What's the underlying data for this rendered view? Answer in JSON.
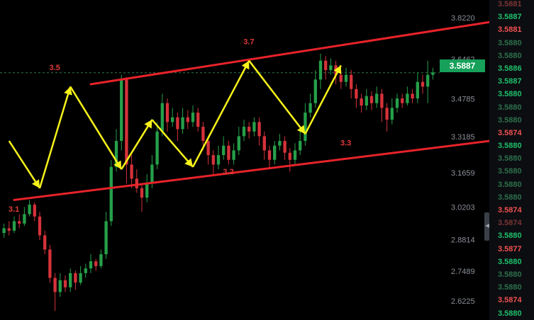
{
  "chart_data": {
    "type": "candlestick",
    "title": "",
    "xlabel": "",
    "ylabel": "",
    "ylim": [
      2.58,
      3.9
    ],
    "y_ticks": [
      "3.8220",
      "3.6462",
      "3.4785",
      "3.3185",
      "3.1659",
      "3.0203",
      "2.8814",
      "2.7489",
      "2.6225"
    ],
    "current_price": "3.5887",
    "current_price_line": 3.5887,
    "candles": [
      [
        2.91,
        2.93,
        2.95,
        2.89
      ],
      [
        2.93,
        2.92,
        2.96,
        2.9
      ],
      [
        2.92,
        2.96,
        2.98,
        2.91
      ],
      [
        2.96,
        2.95,
        2.99,
        2.93
      ],
      [
        2.95,
        2.99,
        3.02,
        2.94
      ],
      [
        2.99,
        3.03,
        3.05,
        2.98
      ],
      [
        3.03,
        2.98,
        3.04,
        2.96
      ],
      [
        2.98,
        2.9,
        3.0,
        2.88
      ],
      [
        2.9,
        2.84,
        2.92,
        2.82
      ],
      [
        2.84,
        2.72,
        2.86,
        2.7
      ],
      [
        2.72,
        2.66,
        2.74,
        2.58
      ],
      [
        2.66,
        2.71,
        2.74,
        2.64
      ],
      [
        2.71,
        2.68,
        2.73,
        2.66
      ],
      [
        2.68,
        2.74,
        2.76,
        2.66
      ],
      [
        2.74,
        2.7,
        2.75,
        2.67
      ],
      [
        2.7,
        2.74,
        2.77,
        2.69
      ],
      [
        2.74,
        2.76,
        2.78,
        2.72
      ],
      [
        2.76,
        2.79,
        2.82,
        2.74
      ],
      [
        2.79,
        2.77,
        2.8,
        2.75
      ],
      [
        2.77,
        2.82,
        2.84,
        2.76
      ],
      [
        2.82,
        2.96,
        3.0,
        2.8
      ],
      [
        2.96,
        3.19,
        3.22,
        2.94
      ],
      [
        3.19,
        3.3,
        3.35,
        3.17
      ],
      [
        3.3,
        3.56,
        3.58,
        3.26
      ],
      [
        3.56,
        3.2,
        3.57,
        3.12
      ],
      [
        3.2,
        3.14,
        3.24,
        3.1
      ],
      [
        3.14,
        3.1,
        3.18,
        3.08
      ],
      [
        3.1,
        3.06,
        3.12,
        3.0
      ],
      [
        3.06,
        3.12,
        3.16,
        3.04
      ],
      [
        3.12,
        3.2,
        3.24,
        3.1
      ],
      [
        3.2,
        3.34,
        3.38,
        3.18
      ],
      [
        3.34,
        3.46,
        3.5,
        3.32
      ],
      [
        3.46,
        3.38,
        3.48,
        3.34
      ],
      [
        3.38,
        3.4,
        3.44,
        3.36
      ],
      [
        3.4,
        3.35,
        3.42,
        3.3
      ],
      [
        3.35,
        3.4,
        3.44,
        3.33
      ],
      [
        3.4,
        3.38,
        3.43,
        3.35
      ],
      [
        3.38,
        3.42,
        3.45,
        3.36
      ],
      [
        3.42,
        3.36,
        3.44,
        3.34
      ],
      [
        3.36,
        3.3,
        3.38,
        3.26
      ],
      [
        3.3,
        3.24,
        3.32,
        3.2
      ],
      [
        3.24,
        3.2,
        3.26,
        3.16
      ],
      [
        3.2,
        3.24,
        3.28,
        3.18
      ],
      [
        3.24,
        3.28,
        3.32,
        3.22
      ],
      [
        3.28,
        3.22,
        3.3,
        3.2
      ],
      [
        3.22,
        3.26,
        3.29,
        3.2
      ],
      [
        3.26,
        3.32,
        3.36,
        3.24
      ],
      [
        3.32,
        3.36,
        3.39,
        3.3
      ],
      [
        3.36,
        3.34,
        3.38,
        3.31
      ],
      [
        3.34,
        3.38,
        3.4,
        3.32
      ],
      [
        3.38,
        3.32,
        3.4,
        3.28
      ],
      [
        3.32,
        3.26,
        3.34,
        3.22
      ],
      [
        3.26,
        3.22,
        3.28,
        3.18
      ],
      [
        3.22,
        3.28,
        3.3,
        3.2
      ],
      [
        3.28,
        3.3,
        3.33,
        3.26
      ],
      [
        3.3,
        3.25,
        3.32,
        3.22
      ],
      [
        3.25,
        3.22,
        3.27,
        3.17
      ],
      [
        3.22,
        3.26,
        3.29,
        3.2
      ],
      [
        3.26,
        3.3,
        3.34,
        3.24
      ],
      [
        3.3,
        3.42,
        3.46,
        3.28
      ],
      [
        3.42,
        3.46,
        3.5,
        3.4
      ],
      [
        3.46,
        3.56,
        3.6,
        3.44
      ],
      [
        3.56,
        3.64,
        3.67,
        3.52
      ],
      [
        3.64,
        3.6,
        3.66,
        3.56
      ],
      [
        3.6,
        3.62,
        3.65,
        3.58
      ],
      [
        3.62,
        3.58,
        3.64,
        3.54
      ],
      [
        3.58,
        3.55,
        3.6,
        3.52
      ],
      [
        3.55,
        3.58,
        3.61,
        3.53
      ],
      [
        3.58,
        3.52,
        3.6,
        3.48
      ],
      [
        3.52,
        3.48,
        3.54,
        3.44
      ],
      [
        3.48,
        3.45,
        3.5,
        3.42
      ],
      [
        3.45,
        3.49,
        3.52,
        3.43
      ],
      [
        3.49,
        3.46,
        3.51,
        3.43
      ],
      [
        3.46,
        3.5,
        3.53,
        3.44
      ],
      [
        3.5,
        3.44,
        3.52,
        3.38
      ],
      [
        3.44,
        3.39,
        3.46,
        3.34
      ],
      [
        3.39,
        3.44,
        3.48,
        3.37
      ],
      [
        3.44,
        3.48,
        3.5,
        3.42
      ],
      [
        3.48,
        3.46,
        3.5,
        3.44
      ],
      [
        3.46,
        3.5,
        3.53,
        3.45
      ],
      [
        3.5,
        3.48,
        3.52,
        3.46
      ],
      [
        3.48,
        3.55,
        3.59,
        3.46
      ],
      [
        3.55,
        3.53,
        3.58,
        3.5
      ],
      [
        3.53,
        3.58,
        3.64,
        3.46
      ],
      [
        3.58,
        3.59,
        3.61,
        3.56
      ]
    ],
    "trend_lines": [
      {
        "name": "upper-channel",
        "color": "#e8232a",
        "points": [
          [
            17,
            3.54
          ],
          [
            103,
            3.83
          ]
        ]
      },
      {
        "name": "lower-channel",
        "color": "#e8232a",
        "points": [
          [
            2,
            3.05
          ],
          [
            110,
            3.34
          ]
        ]
      }
    ],
    "zigzag": {
      "color": "#f5f21a",
      "points": [
        [
          1,
          3.3
        ],
        [
          7,
          3.1
        ],
        [
          13,
          3.53
        ],
        [
          23,
          3.18
        ],
        [
          29,
          3.39
        ],
        [
          37,
          3.19
        ],
        [
          48,
          3.64
        ],
        [
          59,
          3.33
        ],
        [
          66,
          3.62
        ]
      ]
    },
    "annotations": [
      {
        "text": "3.5",
        "x": 10,
        "y": 3.6
      },
      {
        "text": "3.7",
        "x": 48,
        "y": 3.71
      },
      {
        "text": "3.1",
        "x": 2,
        "y": 3.0
      },
      {
        "text": "3.2",
        "x": 44,
        "y": 3.16
      },
      {
        "text": "3.3",
        "x": 67,
        "y": 3.28
      }
    ],
    "x_scale": {
      "first_candle_x": 0,
      "last_candle_x": 84
    }
  },
  "trades_panel": {
    "prices": [
      {
        "value": "3.5881",
        "dir": "down",
        "faded": true
      },
      {
        "value": "3.5887",
        "dir": "up",
        "faded": false
      },
      {
        "value": "3.5881",
        "dir": "down",
        "faded": false
      },
      {
        "value": "3.5880",
        "dir": "up",
        "faded": true
      },
      {
        "value": "3.5880",
        "dir": "up",
        "faded": true
      },
      {
        "value": "3.5886",
        "dir": "up",
        "faded": false
      },
      {
        "value": "3.5887",
        "dir": "up",
        "faded": false
      },
      {
        "value": "3.5880",
        "dir": "up",
        "faded": false
      },
      {
        "value": "3.5880",
        "dir": "up",
        "faded": true
      },
      {
        "value": "3.5880",
        "dir": "up",
        "faded": true
      },
      {
        "value": "3.5874",
        "dir": "down",
        "faded": false
      },
      {
        "value": "3.5880",
        "dir": "up",
        "faded": false
      },
      {
        "value": "3.5880",
        "dir": "up",
        "faded": true
      },
      {
        "value": "3.5880",
        "dir": "up",
        "faded": true
      },
      {
        "value": "3.5880",
        "dir": "up",
        "faded": true
      },
      {
        "value": "3.5880",
        "dir": "up",
        "faded": true
      },
      {
        "value": "3.5874",
        "dir": "down",
        "faded": false
      },
      {
        "value": "3.5874",
        "dir": "down",
        "faded": true
      },
      {
        "value": "3.5880",
        "dir": "up",
        "faded": false
      },
      {
        "value": "3.5877",
        "dir": "down",
        "faded": false
      },
      {
        "value": "3.5880",
        "dir": "up",
        "faded": false
      },
      {
        "value": "3.5880",
        "dir": "up",
        "faded": true
      },
      {
        "value": "3.5880",
        "dir": "up",
        "faded": true
      },
      {
        "value": "3.5874",
        "dir": "down",
        "faded": false
      },
      {
        "value": "3.5880",
        "dir": "up",
        "faded": false
      }
    ]
  },
  "colors": {
    "up": "#26a04a",
    "down": "#d6323a",
    "grid_dash": "#2c7a4a",
    "axis_text": "#8a8f98",
    "price_tag_bg": "#16a05a"
  },
  "icons": {
    "scroll_handle": "collapse-arrow-icon"
  }
}
